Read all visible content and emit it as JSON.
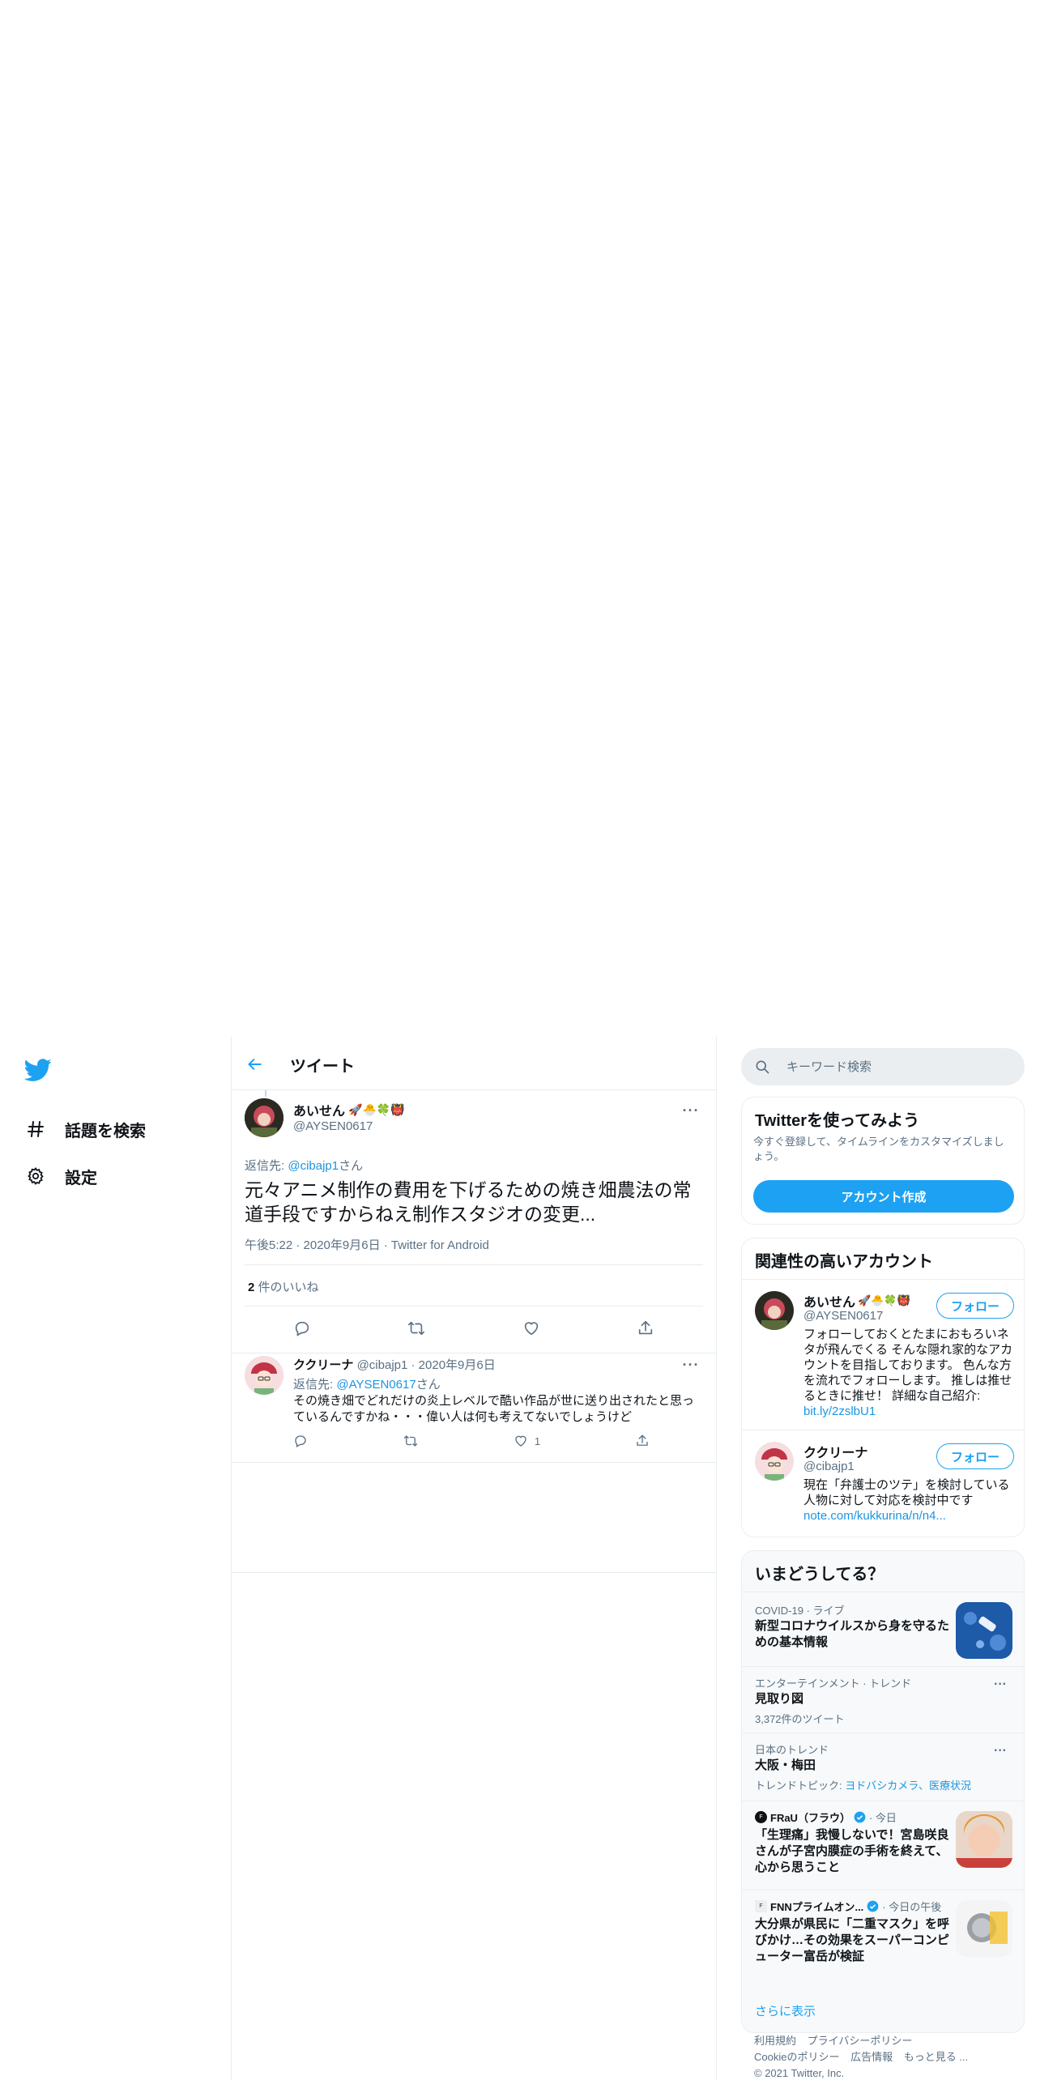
{
  "nav": {
    "explore_label": "話題を検索",
    "settings_label": "設定"
  },
  "header": {
    "title": "ツイート"
  },
  "tweet": {
    "name": "あいせん",
    "handle": "@AYSEN0617",
    "reply_prefix": "返信先: ",
    "reply_to": "@cibajp1",
    "reply_suffix": "さん",
    "text": "元々アニメ制作の費用を下げるための焼き畑農法の常道手段ですからねえ制作スタジオの変更...",
    "meta": "午後5:22 · 2020年9月6日 · Twitter for Android",
    "likes_count": "2",
    "likes_label": " 件のいいね"
  },
  "reply": {
    "name": "ククリーナ",
    "handle_date": " @cibajp1 · 2020年9月6日",
    "reply_prefix": "返信先: ",
    "reply_to": "@AYSEN0617",
    "reply_suffix": "さん",
    "text": "その焼き畑でどれだけの炎上レベルで酷い作品が世に送り出されたと思っているんですかね・・・偉い人は何も考えてないでしょうけど",
    "like_count": "1"
  },
  "search": {
    "placeholder": "キーワード検索"
  },
  "signup": {
    "title": "Twitterを使ってみよう",
    "desc": "今すぐ登録して、タイムラインをカスタマイズしましょう。",
    "button": "アカウント作成"
  },
  "related": {
    "title": "関連性の高いアカウント",
    "follow_label": "フォロー",
    "accounts": [
      {
        "name": "あいせん",
        "handle": "@AYSEN0617",
        "bio": "フォローしておくとたまにおもろいネタが飛んでくる そんな隠れ家的なアカウントを目指しております。 色んな方を流れでフォローします。 推しは推せるときに推せ！ 詳細な自己紹介: ",
        "bio_link": "bit.ly/2zslbU1"
      },
      {
        "name": "ククリーナ",
        "handle": "@cibajp1",
        "bio": "現在「弁護士のツテ」を検討している人物に対して対応を検討中です ",
        "bio_link": "note.com/kukkurina/n/n4..."
      }
    ]
  },
  "trends": {
    "title": "いまどうしてる？",
    "items": [
      {
        "category": "COVID-19 · ライブ",
        "title": "新型コロナウイルスから身を守るための基本情報"
      },
      {
        "category": "エンターテインメント · トレンド",
        "title": "見取り図",
        "sub": "3,372件のツイート"
      },
      {
        "category": "日本のトレンド",
        "title": "大阪・梅田",
        "sub_prefix": "トレンドトピック: ",
        "sub_links": "ヨドバシカメラ、医療状況"
      },
      {
        "source": "FRaU（フラウ）",
        "time": " · 今日",
        "title": "「生理痛」我慢しないで！宮島咲良さんが子宮内膜症の手術を終えて、心から思うこと"
      },
      {
        "source": "FNNプライムオン...",
        "time": " · 今日の午後",
        "title": "大分県が県民に「二重マスク」を呼びかけ…その効果をスーパーコンピューター富岳が検証"
      }
    ],
    "show_more": "さらに表示"
  },
  "footer": {
    "links": [
      "利用規約",
      "プライバシーポリシー",
      "Cookieのポリシー",
      "広告情報",
      "もっと見る ..."
    ],
    "copyright": "© 2021 Twitter, Inc."
  },
  "colors": {
    "brand": "#1da1f2",
    "link": "#1b95e0",
    "secondary_text": "#5b7083"
  }
}
